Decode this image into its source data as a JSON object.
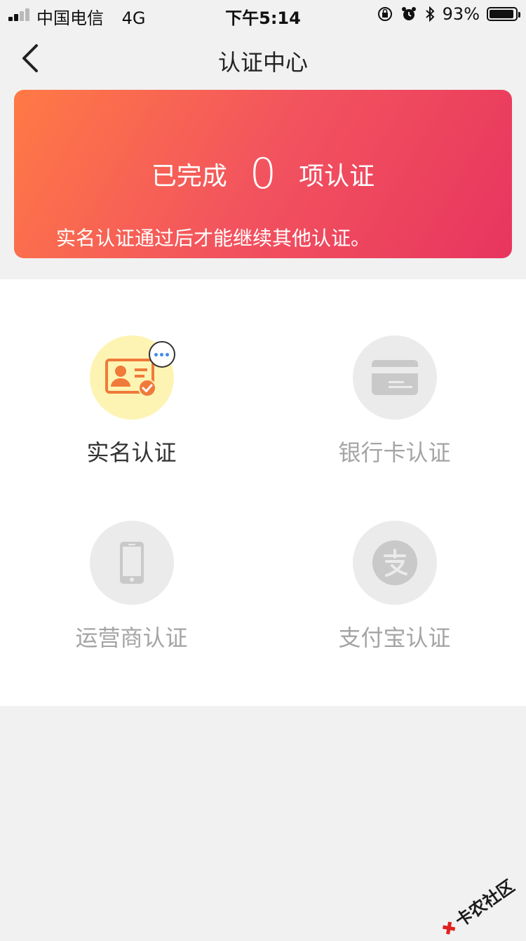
{
  "status_bar": {
    "carrier": "中国电信",
    "network": "4G",
    "time": "下午5:14",
    "battery_text": "93%"
  },
  "nav": {
    "title": "认证中心",
    "back_icon": "chevron-left-icon"
  },
  "banner": {
    "prefix": "已完成",
    "count": "0",
    "suffix": "项认证",
    "note": "实名认证通过后才能继续其他认证。",
    "gradient_colors": [
      "#ff7a45",
      "#e8355f"
    ]
  },
  "auth_items": [
    {
      "label": "实名认证",
      "icon": "id-card-icon",
      "state": "active"
    },
    {
      "label": "银行卡认证",
      "icon": "bank-card-icon",
      "state": "inactive"
    },
    {
      "label": "运营商认证",
      "icon": "phone-icon",
      "state": "inactive"
    },
    {
      "label": "支付宝认证",
      "icon": "alipay-icon",
      "state": "inactive"
    }
  ],
  "watermark": "卡农社区"
}
